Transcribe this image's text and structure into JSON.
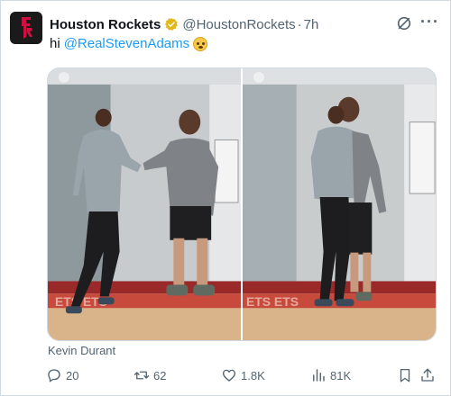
{
  "tweet": {
    "author_name": "Houston Rockets",
    "handle": "@HoustonRockets",
    "separator": "·",
    "time": "7h",
    "text_prefix": "hi",
    "mention": "@RealStevenAdams",
    "emoji": "face-holding-back-tears-emoji"
  },
  "media": {
    "photo_count": 2,
    "caption": "Kevin Durant"
  },
  "actions": {
    "replies": "20",
    "reposts": "62",
    "likes": "1.8K",
    "views": "81K"
  },
  "colors": {
    "link": "#1d9bf0",
    "verified_badge": "#e2b719",
    "secondary_text": "#536471",
    "rockets_red": "#ce1141"
  },
  "icons": [
    "rockets-logo-icon",
    "verified-badge-icon",
    "grok-icon",
    "more-icon",
    "reply-icon",
    "repost-icon",
    "like-icon",
    "views-icon",
    "bookmark-icon",
    "share-icon"
  ]
}
